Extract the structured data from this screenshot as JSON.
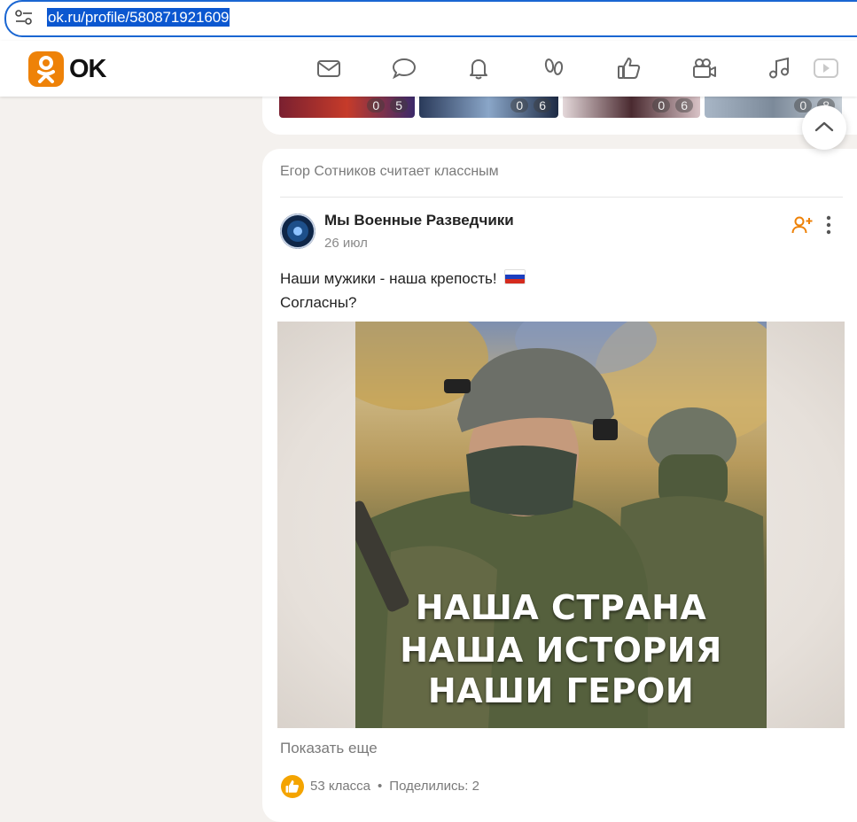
{
  "browser": {
    "url": "ok.ru/profile/580871921609"
  },
  "header": {
    "logo_text": "OK",
    "nav_icons": [
      "mail-icon",
      "chat-icon",
      "bell-icon",
      "guests-icon",
      "like-icon",
      "video-camera-icon",
      "music-icon",
      "video-play-icon"
    ],
    "accent": "#ee8208"
  },
  "previous_post": {
    "thumbnails": [
      {
        "comments": "0",
        "likes": "5"
      },
      {
        "comments": "0",
        "likes": "6"
      },
      {
        "comments": "0",
        "likes": "6"
      },
      {
        "comments": "0",
        "likes": "8"
      }
    ]
  },
  "feed_item": {
    "liked_by": "Егор Сотников считает классным",
    "author": "Мы Военные Разведчики",
    "date": "26 июл",
    "text_line1": "Наши мужики - наша крепость!",
    "text_line2": "Согласны?",
    "image_caption": [
      "НАША СТРАНА",
      "НАША ИСТОРИЯ",
      "НАШИ ГЕРОИ"
    ],
    "show_more": "Показать еще",
    "likes": "53 класса",
    "separator": "•",
    "shares": "Поделились: 2"
  }
}
